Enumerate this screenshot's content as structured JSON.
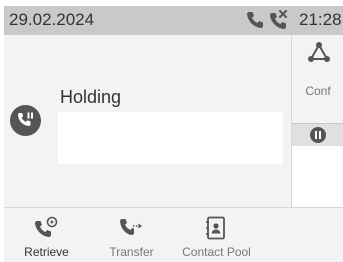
{
  "status_bar": {
    "date": "29.02.2024",
    "time": "21:28",
    "icons": [
      "phone-icon",
      "missed-call-icon"
    ]
  },
  "call": {
    "status": "Holding",
    "avatar_icon": "call-hold-icon",
    "info_box_text": ""
  },
  "side_panel": {
    "conf_label": "Conf",
    "conf_icon": "conference-icon",
    "hold_icon": "pause-icon"
  },
  "softkeys": [
    {
      "label": "Retrieve",
      "icon": "retrieve-icon"
    },
    {
      "label": "Transfer",
      "icon": "transfer-icon"
    },
    {
      "label": "Contact Pool",
      "icon": "contact-pool-icon"
    }
  ],
  "colors": {
    "status_bar_bg": "#c9c9c9",
    "screen_bg": "#f3f3f3",
    "icon_dark": "#555555",
    "text_dark": "#333333",
    "text_muted": "#777777"
  }
}
